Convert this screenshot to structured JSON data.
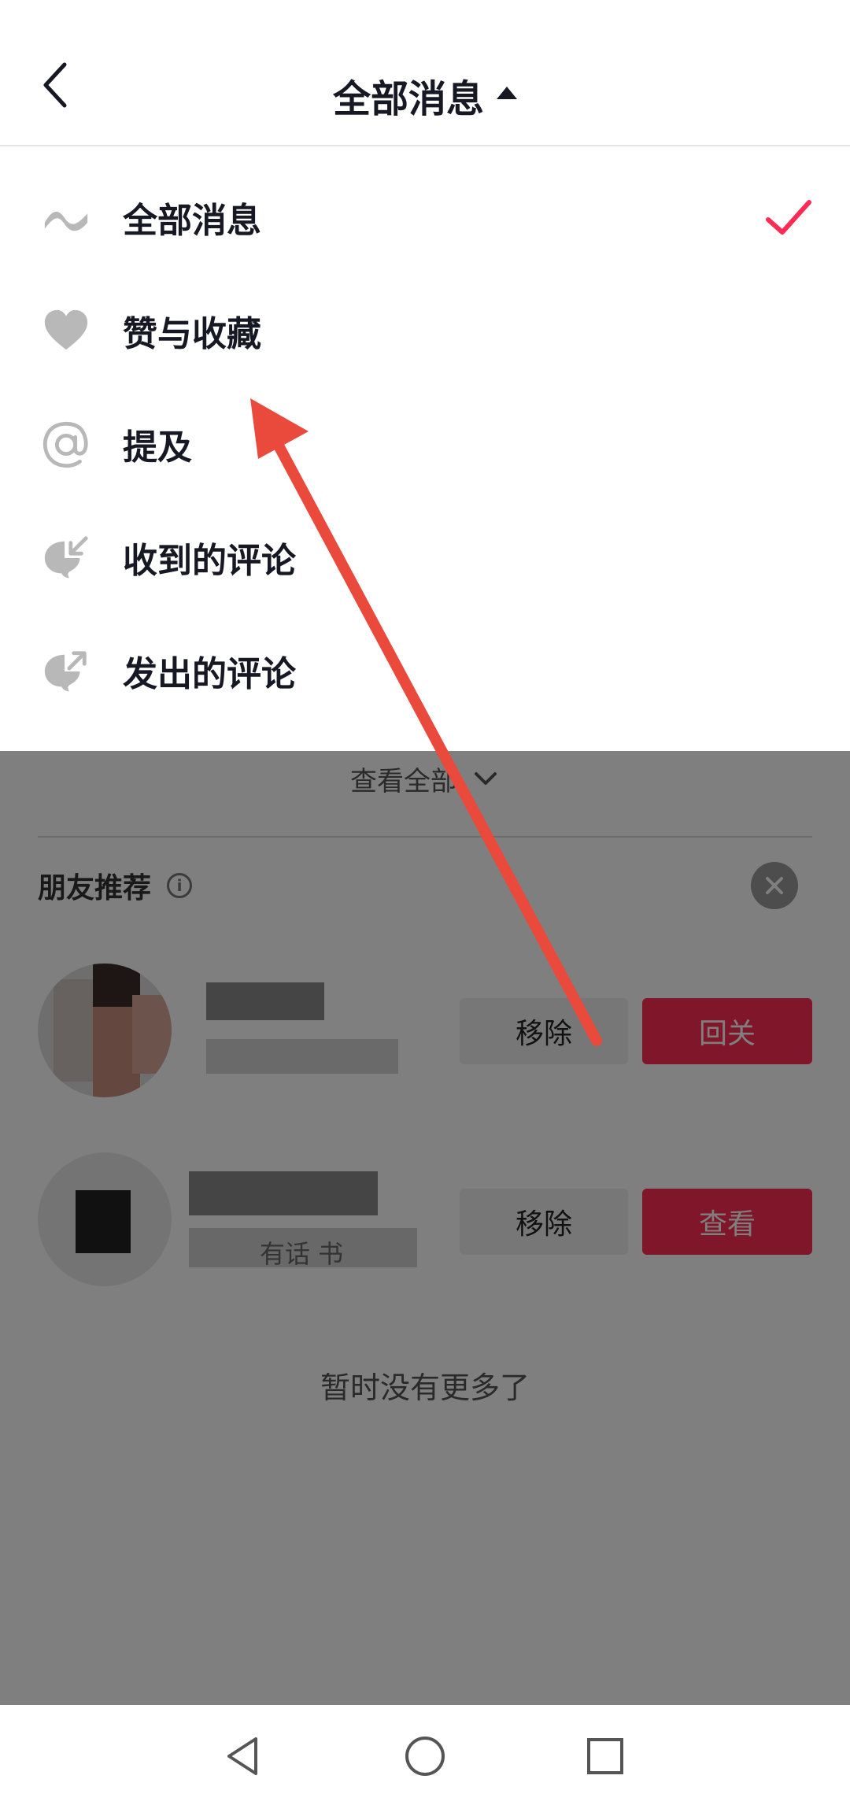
{
  "header": {
    "title": "全部消息"
  },
  "menu": {
    "items": [
      {
        "label": "全部消息",
        "icon": "wave-icon",
        "selected": true
      },
      {
        "label": "赞与收藏",
        "icon": "heart-icon",
        "selected": false
      },
      {
        "label": "提及",
        "icon": "at-icon",
        "selected": false
      },
      {
        "label": "收到的评论",
        "icon": "comment-received-icon",
        "selected": false
      },
      {
        "label": "发出的评论",
        "icon": "comment-sent-icon",
        "selected": false
      }
    ]
  },
  "background": {
    "view_all_label": "查看全部",
    "friends_title": "朋友推荐",
    "friends": [
      {
        "remove_label": "移除",
        "action_label": "回关"
      },
      {
        "remove_label": "移除",
        "action_label": "查看"
      }
    ],
    "second_subtitle_fragment": "有话 书",
    "no_more_label": "暂时没有更多了"
  },
  "colors": {
    "accent": "#fe2c55",
    "check": "#fe2c55",
    "annotation_arrow": "#e94a3c",
    "overlay": "rgba(0,0,0,0.5)"
  }
}
